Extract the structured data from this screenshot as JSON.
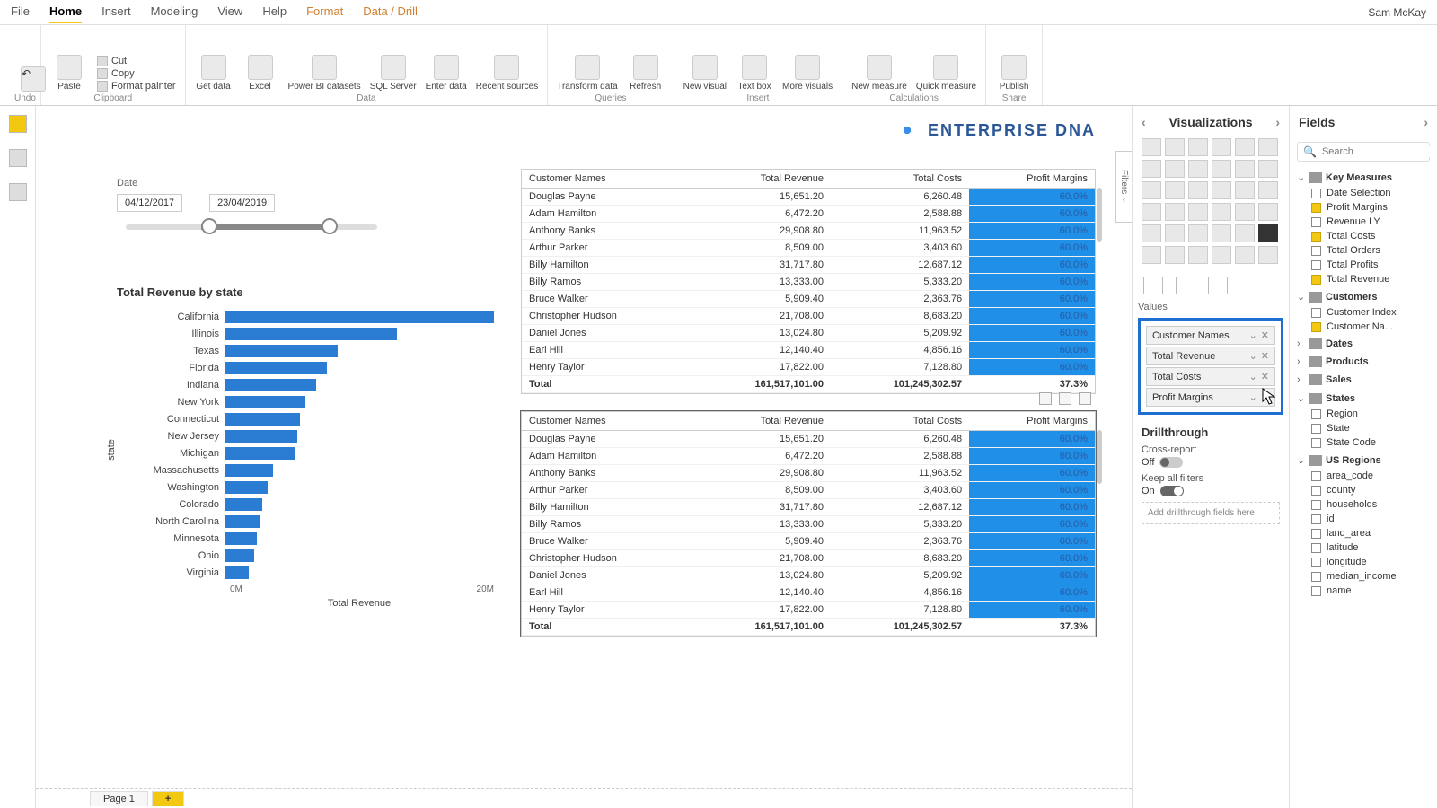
{
  "user": "Sam McKay",
  "menus": [
    "File",
    "Home",
    "Insert",
    "Modeling",
    "View",
    "Help",
    "Format",
    "Data / Drill"
  ],
  "active_menu": "Home",
  "ribbon": {
    "undo": "Undo",
    "clipboard": {
      "paste": "Paste",
      "cut": "Cut",
      "copy": "Copy",
      "format_painter": "Format painter",
      "label": "Clipboard"
    },
    "data": {
      "get": "Get data",
      "excel": "Excel",
      "pbi": "Power BI datasets",
      "sql": "SQL Server",
      "enter": "Enter data",
      "recent": "Recent sources",
      "label": "Data"
    },
    "queries": {
      "transform": "Transform data",
      "refresh": "Refresh",
      "label": "Queries"
    },
    "insert": {
      "visual": "New visual",
      "text": "Text box",
      "more": "More visuals",
      "label": "Insert"
    },
    "calc": {
      "measure": "New measure",
      "quick": "Quick measure",
      "label": "Calculations"
    },
    "share": {
      "publish": "Publish",
      "label": "Share"
    }
  },
  "logo_text": "ENTERPRISE DNA",
  "filters_tab": "Filters",
  "slicer": {
    "title": "Date",
    "from": "04/12/2017",
    "to": "23/04/2019"
  },
  "chart_data": {
    "type": "bar",
    "title": "Total Revenue by state",
    "ylabel": "state",
    "xlabel": "Total Revenue",
    "xticks": [
      "0M",
      "20M"
    ],
    "categories": [
      "California",
      "Illinois",
      "Texas",
      "Florida",
      "Indiana",
      "New York",
      "Connecticut",
      "New Jersey",
      "Michigan",
      "Massachusetts",
      "Washington",
      "Colorado",
      "North Carolina",
      "Minnesota",
      "Ohio",
      "Virginia"
    ],
    "values": [
      100,
      64,
      42,
      38,
      34,
      30,
      28,
      27,
      26,
      18,
      16,
      14,
      13,
      12,
      11,
      9
    ]
  },
  "table": {
    "columns": [
      "Customer Names",
      "Total Revenue",
      "Total Costs",
      "Profit Margins"
    ],
    "rows": [
      {
        "name": "Douglas Payne",
        "rev": "15,651.20",
        "cost": "6,260.48",
        "pm": "60.0%"
      },
      {
        "name": "Adam Hamilton",
        "rev": "6,472.20",
        "cost": "2,588.88",
        "pm": "60.0%"
      },
      {
        "name": "Anthony Banks",
        "rev": "29,908.80",
        "cost": "11,963.52",
        "pm": "60.0%"
      },
      {
        "name": "Arthur Parker",
        "rev": "8,509.00",
        "cost": "3,403.60",
        "pm": "60.0%"
      },
      {
        "name": "Billy Hamilton",
        "rev": "31,717.80",
        "cost": "12,687.12",
        "pm": "60.0%"
      },
      {
        "name": "Billy Ramos",
        "rev": "13,333.00",
        "cost": "5,333.20",
        "pm": "60.0%"
      },
      {
        "name": "Bruce Walker",
        "rev": "5,909.40",
        "cost": "2,363.76",
        "pm": "60.0%"
      },
      {
        "name": "Christopher Hudson",
        "rev": "21,708.00",
        "cost": "8,683.20",
        "pm": "60.0%"
      },
      {
        "name": "Daniel Jones",
        "rev": "13,024.80",
        "cost": "5,209.92",
        "pm": "60.0%"
      },
      {
        "name": "Earl Hill",
        "rev": "12,140.40",
        "cost": "4,856.16",
        "pm": "60.0%"
      },
      {
        "name": "Henry Taylor",
        "rev": "17,822.00",
        "cost": "7,128.80",
        "pm": "60.0%"
      }
    ],
    "total": {
      "label": "Total",
      "rev": "161,517,101.00",
      "cost": "101,245,302.57",
      "pm": "37.3%"
    }
  },
  "viz_panel": {
    "title": "Visualizations",
    "values_label": "Values",
    "wells": [
      "Customer Names",
      "Total Revenue",
      "Total Costs",
      "Profit Margins"
    ],
    "drill_title": "Drillthrough",
    "cross_report": "Cross-report",
    "off": "Off",
    "keep_filters": "Keep all filters",
    "on": "On",
    "drop_hint": "Add drillthrough fields here"
  },
  "fields_panel": {
    "title": "Fields",
    "search_placeholder": "Search",
    "groups": [
      {
        "name": "Key Measures",
        "expanded": true,
        "items": [
          {
            "label": "Date Selection",
            "checked": false
          },
          {
            "label": "Profit Margins",
            "checked": true
          },
          {
            "label": "Revenue LY",
            "checked": false
          },
          {
            "label": "Total Costs",
            "checked": true
          },
          {
            "label": "Total Orders",
            "checked": false
          },
          {
            "label": "Total Profits",
            "checked": false
          },
          {
            "label": "Total Revenue",
            "checked": true
          }
        ]
      },
      {
        "name": "Customers",
        "expanded": true,
        "items": [
          {
            "label": "Customer Index",
            "checked": false
          },
          {
            "label": "Customer Na...",
            "checked": true
          }
        ]
      },
      {
        "name": "Dates",
        "expanded": false,
        "items": []
      },
      {
        "name": "Products",
        "expanded": false,
        "items": []
      },
      {
        "name": "Sales",
        "expanded": false,
        "items": []
      },
      {
        "name": "States",
        "expanded": true,
        "items": [
          {
            "label": "Region",
            "checked": false
          },
          {
            "label": "State",
            "checked": false
          },
          {
            "label": "State Code",
            "checked": false
          }
        ]
      },
      {
        "name": "US Regions",
        "expanded": true,
        "items": [
          {
            "label": "area_code",
            "checked": false
          },
          {
            "label": "county",
            "checked": false
          },
          {
            "label": "households",
            "checked": false
          },
          {
            "label": "id",
            "checked": false
          },
          {
            "label": "land_area",
            "checked": false
          },
          {
            "label": "latitude",
            "checked": false
          },
          {
            "label": "longitude",
            "checked": false
          },
          {
            "label": "median_income",
            "checked": false
          },
          {
            "label": "name",
            "checked": false
          }
        ]
      }
    ]
  },
  "page_tabs": {
    "page": "Page 1",
    "add": "+"
  }
}
